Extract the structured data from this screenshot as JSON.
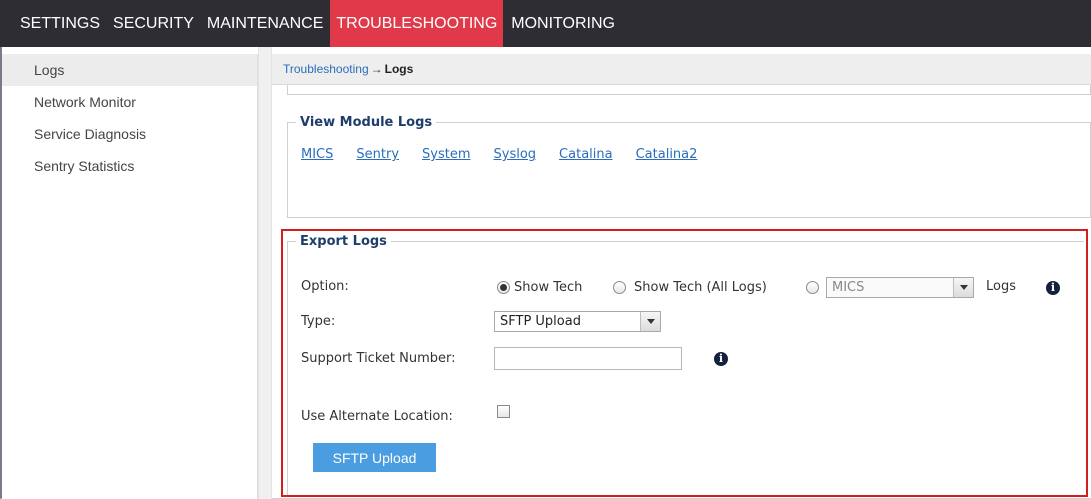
{
  "topnav": {
    "tabs": [
      "SETTINGS",
      "SECURITY",
      "MAINTENANCE",
      "TROUBLESHOOTING",
      "MONITORING"
    ],
    "active": "TROUBLESHOOTING"
  },
  "sidebar": {
    "items": [
      {
        "label": "Logs"
      },
      {
        "label": "Network Monitor"
      },
      {
        "label": "Service Diagnosis"
      },
      {
        "label": "Sentry Statistics"
      }
    ]
  },
  "breadcrumb": {
    "parent": "Troubleshooting",
    "arrow": "→",
    "current": "Logs"
  },
  "view_module_logs": {
    "legend": "View Module Logs",
    "links": [
      "MICS",
      "Sentry",
      "System",
      "Syslog",
      "Catalina",
      "Catalina2"
    ]
  },
  "export_logs": {
    "legend": "Export Logs",
    "option_label": "Option:",
    "options": [
      "Show Tech",
      "Show Tech (All Logs)"
    ],
    "selected_option": "Show Tech",
    "module_select_value": "MICS",
    "logs_suffix": "Logs",
    "type_label": "Type:",
    "type_value": "SFTP Upload",
    "ticket_label": "Support Ticket Number:",
    "ticket_value": "",
    "alt_location_label": "Use Alternate Location:",
    "alt_location_checked": false,
    "submit_label": "SFTP Upload"
  },
  "colors": {
    "nav_bg": "#2d2d33",
    "nav_active": "#e03a4a",
    "link": "#2a6ebb",
    "highlight_border": "#d0201e",
    "button_bg": "#4a9de0"
  }
}
